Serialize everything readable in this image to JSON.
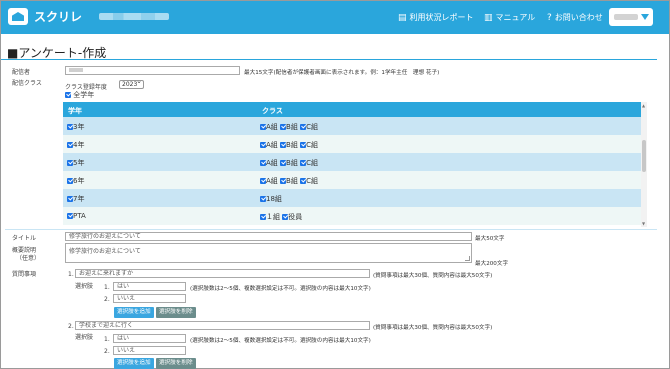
{
  "header": {
    "logo_text": "スクリレ",
    "nav_report": "利用状況レポート",
    "nav_manual": "マニュアル",
    "nav_contact": "お問い合わせ"
  },
  "page": {
    "title": "■アンケート-作成"
  },
  "form": {
    "sender_label": "配信者",
    "sender_note": "最大15文字(配信者が保護者画面に表示されます。例：1学年主任　理想 花子)",
    "class_label": "配信クラス",
    "class_year_label": "クラス登録年度",
    "class_year_value": "2023",
    "all_grades_label": "全学年",
    "grid_headers": {
      "grade": "学年",
      "class": "クラス"
    },
    "rows": [
      {
        "grade": "3年",
        "classes": [
          "A組",
          "B組",
          "C組"
        ]
      },
      {
        "grade": "4年",
        "classes": [
          "A組",
          "B組",
          "C組"
        ]
      },
      {
        "grade": "5年",
        "classes": [
          "A組",
          "B組",
          "C組"
        ]
      },
      {
        "grade": "6年",
        "classes": [
          "A組",
          "B組",
          "C組"
        ]
      },
      {
        "grade": "7年",
        "classes": [
          "18組"
        ]
      },
      {
        "grade": "PTA",
        "classes": [
          "１組",
          "役員"
        ]
      }
    ],
    "title_label": "タイトル",
    "title_value": "修学旅行のお迎えについて",
    "title_note": "最大50文字",
    "desc_label_1": "概要説明",
    "desc_label_2": "（任意）",
    "desc_value": "修学旅行のお迎えについて",
    "desc_note": "最大200文字",
    "questions_label": "質問事項",
    "choices_label": "選択肢",
    "question_note": "(質問事項は最大30個、質問内容は最大50文字)",
    "choice_note": "(選択肢数は2〜5個、複数選択設定は不可。選択肢の内容は最大10文字)",
    "add_choice": "選択肢を追加",
    "del_choice": "選択肢を削除",
    "questions": [
      {
        "num": "1.",
        "text": "お迎えに来れますか",
        "choices": [
          {
            "num": "1.",
            "text": "はい"
          },
          {
            "num": "2.",
            "text": "いいえ"
          }
        ]
      },
      {
        "num": "2.",
        "text": "学校まで迎えに行く",
        "choices": [
          {
            "num": "1.",
            "text": "はい"
          },
          {
            "num": "2.",
            "text": "いいえ"
          }
        ]
      }
    ]
  }
}
